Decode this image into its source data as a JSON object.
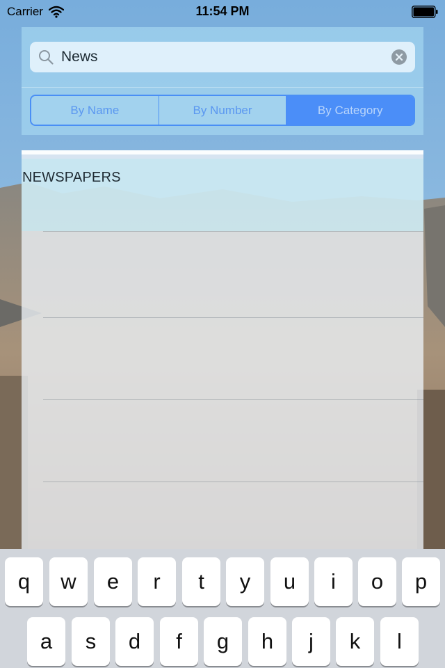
{
  "status_bar": {
    "carrier": "Carrier",
    "time": "11:54 PM"
  },
  "search": {
    "value": "News",
    "icon": "search-icon",
    "clear_icon": "clear-icon"
  },
  "segments": [
    {
      "label": "By Name",
      "selected": false
    },
    {
      "label": "By Number",
      "selected": false
    },
    {
      "label": "By Category",
      "selected": true
    }
  ],
  "results": {
    "section_title": "NEWSPAPERS",
    "rows": [
      "",
      "",
      ""
    ]
  },
  "keyboard": {
    "row1": [
      "q",
      "w",
      "e",
      "r",
      "t",
      "y",
      "u",
      "i",
      "o",
      "p"
    ],
    "row2": [
      "a",
      "s",
      "d",
      "f",
      "g",
      "h",
      "j",
      "k",
      "l"
    ]
  },
  "colors": {
    "accent": "#4b8ef8",
    "panel": "#a4d5f0"
  }
}
